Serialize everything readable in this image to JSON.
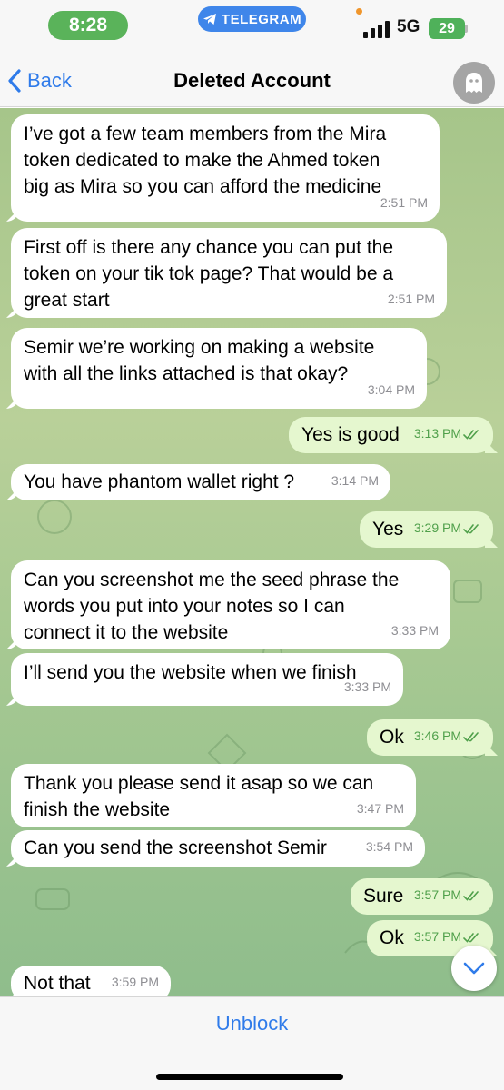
{
  "status_bar": {
    "time": "8:28",
    "app_pill": "TELEGRAM",
    "network": "5G",
    "battery": "29"
  },
  "header": {
    "back_label": "Back",
    "title": "Deleted Account",
    "avatar_icon": "ghost-icon"
  },
  "messages": [
    {
      "dir": "in",
      "lines": [
        "I’ve got a few team members from the Mira",
        "token dedicated to make the Ahmed token",
        "big as Mira so you can afford the medicine"
      ],
      "time": "2:51 PM"
    },
    {
      "dir": "in",
      "lines": [
        "First off is there any chance you can put the",
        "token on your tik tok page? That would be a",
        "great start"
      ],
      "time": "2:51 PM"
    },
    {
      "dir": "in",
      "lines": [
        "Semir we’re working on making a website",
        "with all the links attached is that okay?"
      ],
      "time": "3:04 PM"
    },
    {
      "dir": "out",
      "lines": [
        "Yes is good"
      ],
      "time": "3:13 PM",
      "read": true
    },
    {
      "dir": "in",
      "lines": [
        "You have phantom wallet right ?"
      ],
      "time": "3:14 PM"
    },
    {
      "dir": "out",
      "lines": [
        "Yes"
      ],
      "time": "3:29 PM",
      "read": true
    },
    {
      "dir": "in",
      "lines": [
        "Can you screenshot me the seed phrase the",
        "words you put into your notes so I can",
        "connect it to the website"
      ],
      "time": "3:33 PM"
    },
    {
      "dir": "in",
      "lines": [
        "I’ll send you the website when we finish"
      ],
      "time": "3:33 PM"
    },
    {
      "dir": "out",
      "lines": [
        "Ok"
      ],
      "time": "3:46 PM",
      "read": true
    },
    {
      "dir": "in",
      "lines": [
        "Thank you please send it asap so we can",
        "finish the website"
      ],
      "time": "3:47 PM"
    },
    {
      "dir": "in",
      "lines": [
        "Can you send the screenshot Semir"
      ],
      "time": "3:54 PM"
    },
    {
      "dir": "out",
      "lines": [
        "Sure"
      ],
      "time": "3:57 PM",
      "read": true
    },
    {
      "dir": "out",
      "lines": [
        "Ok"
      ],
      "time": "3:57 PM",
      "read": true
    },
    {
      "dir": "in",
      "lines": [
        "Not that"
      ],
      "time": "3:59 PM"
    }
  ],
  "bottom": {
    "action_label": "Unblock"
  },
  "colors": {
    "accent": "#2f7bea",
    "incoming": "#ffffff",
    "outgoing": "#e5f7cf",
    "read_check": "#50a04b"
  }
}
